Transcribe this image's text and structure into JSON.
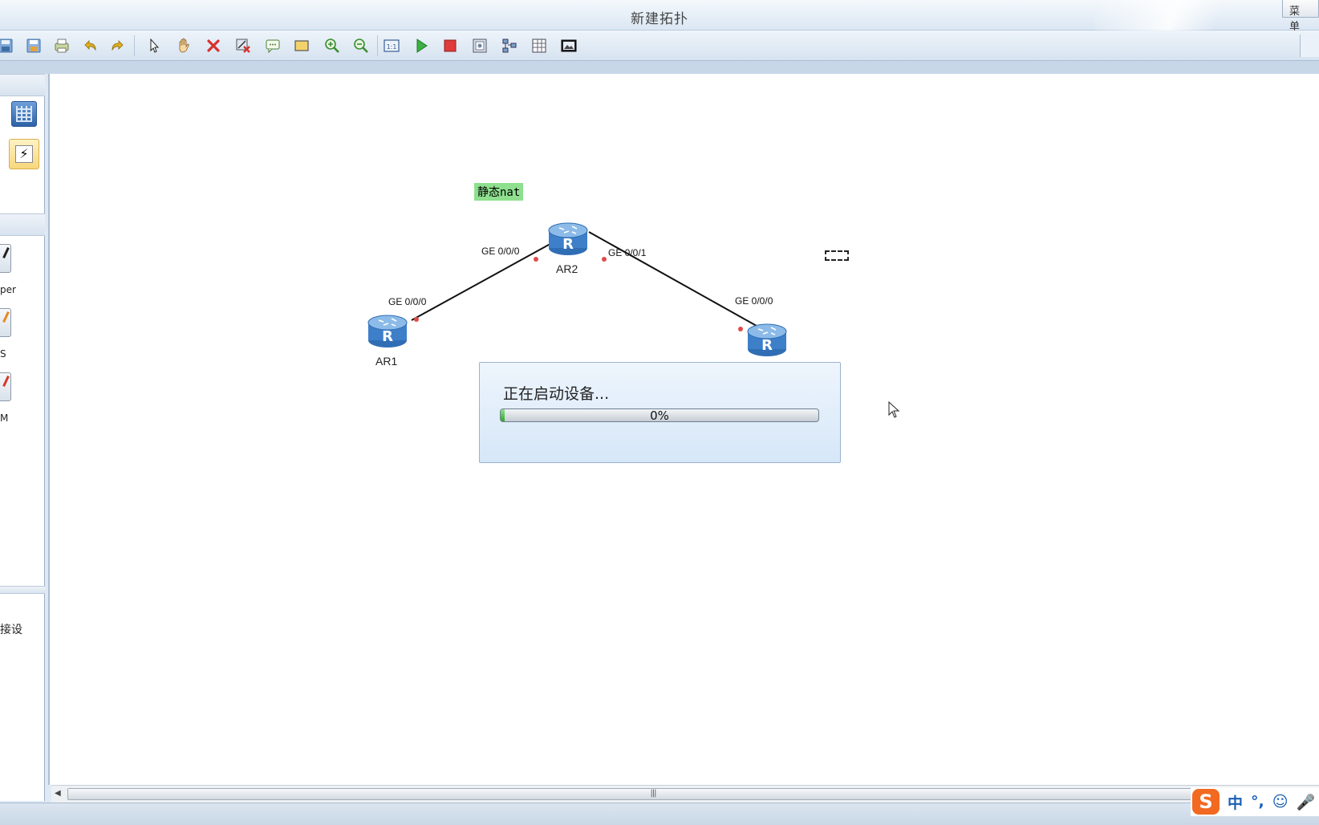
{
  "window": {
    "title": "新建拓扑",
    "menu_label": "菜 单"
  },
  "toolbar": {
    "buttons": [
      "new-icon",
      "save-icon",
      "save-as-icon",
      "print-icon",
      "undo-icon",
      "redo-icon",
      "select-icon",
      "pan-icon",
      "delete-icon",
      "delete-link-icon",
      "text-note-icon",
      "rectangle-icon",
      "zoom-in-icon",
      "zoom-out-icon",
      "fit-icon",
      "start-device-icon",
      "stop-device-icon",
      "capture-icon",
      "topology-icon",
      "grid-icon",
      "screenshot-icon"
    ]
  },
  "left_panel": {
    "device_labels": [
      "per",
      "S",
      "M"
    ],
    "section_text": "接设"
  },
  "topology": {
    "note": "静态nat",
    "devices": [
      {
        "name": "AR1"
      },
      {
        "name": "AR2"
      },
      {
        "name": ""
      }
    ],
    "interfaces": {
      "ar1_left": "GE 0/0/0",
      "ar2_left": "GE 0/0/0",
      "ar2_right": "GE 0/0/1",
      "ar3_top": "GE 0/0/0"
    }
  },
  "dialog": {
    "message": "正在启动设备...",
    "progress_percent": 0,
    "progress_text": "0%"
  },
  "ime": {
    "logo": "S",
    "items": [
      "中",
      "°,",
      "☺",
      "🎤"
    ]
  },
  "colors": {
    "note_bg": "#8ee08e",
    "router_blue": "#3d7fc8",
    "port_dot": "#e04b4b",
    "dialog_bg": "#e3eefa",
    "ime_orange": "#f26a21"
  }
}
